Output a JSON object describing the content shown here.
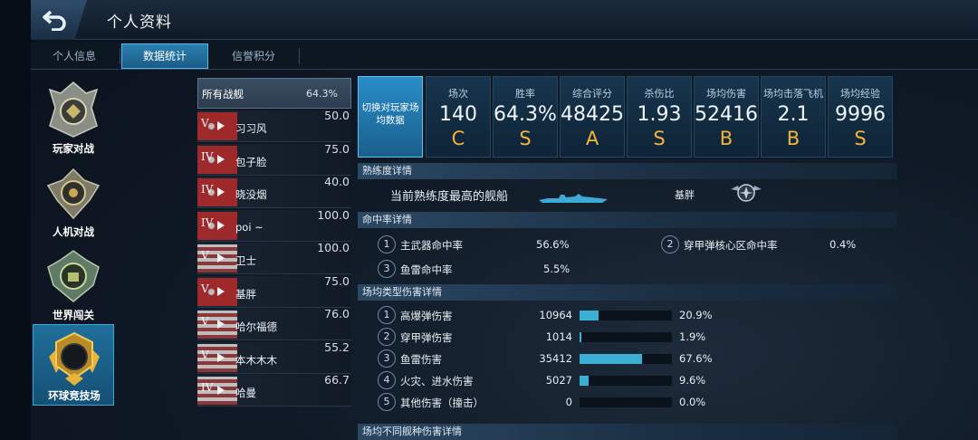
{
  "header": {
    "title": "个人资料"
  },
  "tabs": [
    "个人信息",
    "数据统计",
    "信誉积分"
  ],
  "active_tab": 1,
  "modes": [
    "玩家对战",
    "人机对战",
    "世界闯关",
    "环球竞技场"
  ],
  "active_mode": 3,
  "ship_list": {
    "all_label": "所有战舰",
    "all_rate": "64.3%",
    "ships": [
      {
        "tier": "V",
        "name": "习习风",
        "value": "50.0"
      },
      {
        "tier": "IV",
        "name": "包子脸",
        "value": "75.0"
      },
      {
        "tier": "IV",
        "name": "晓没烟",
        "value": "40.0"
      },
      {
        "tier": "IV",
        "name": "poi ~",
        "value": "100.0"
      },
      {
        "tier": "V",
        "name": "卫士",
        "value": "100.0"
      },
      {
        "tier": "V",
        "name": "基胖",
        "value": "75.0"
      },
      {
        "tier": "V",
        "name": "哈尔福德",
        "value": "76.0"
      },
      {
        "tier": "V",
        "name": "本木木木",
        "value": "55.2"
      },
      {
        "tier": "IV",
        "name": "哈曼",
        "value": "66.7"
      }
    ]
  },
  "switch_label": "切换对玩家场均数据",
  "stat_columns": [
    {
      "label": "场次",
      "value": "140",
      "grade": "C"
    },
    {
      "label": "胜率",
      "value": "64.3%",
      "grade": "S"
    },
    {
      "label": "综合评分",
      "value": "48425",
      "grade": "A"
    },
    {
      "label": "杀伤比",
      "value": "1.93",
      "grade": "S"
    },
    {
      "label": "场均伤害",
      "value": "52416",
      "grade": "B"
    },
    {
      "label": "场均击落飞机",
      "value": "2.1",
      "grade": "B"
    },
    {
      "label": "场均经验",
      "value": "9996",
      "grade": "S"
    }
  ],
  "proficiency": {
    "title": "熟练度详情",
    "label": "当前熟练度最高的舰船",
    "ship": "基胖"
  },
  "accuracy": {
    "title": "命中率详情",
    "items": [
      {
        "num": "1",
        "label": "主武器命中率",
        "value": "56.6%"
      },
      {
        "num": "2",
        "label": "穿甲弹核心区命中率",
        "value": "0.4%"
      },
      {
        "num": "3",
        "label": "鱼雷命中率",
        "value": "5.5%"
      }
    ]
  },
  "damage_types": {
    "title": "场均类型伤害详情",
    "items": [
      {
        "num": "1",
        "label": "高爆弹伤害",
        "value": "10964",
        "pct": "20.9%",
        "fraction": 0.209
      },
      {
        "num": "2",
        "label": "穿甲弹伤害",
        "value": "1014",
        "pct": "1.9%",
        "fraction": 0.019
      },
      {
        "num": "3",
        "label": "鱼雷伤害",
        "value": "35412",
        "pct": "67.6%",
        "fraction": 0.676
      },
      {
        "num": "4",
        "label": "火灾、进水伤害",
        "value": "5027",
        "pct": "9.6%",
        "fraction": 0.096
      },
      {
        "num": "5",
        "label": "其他伤害（撞击）",
        "value": "0",
        "pct": "0.0%",
        "fraction": 0.0
      }
    ]
  },
  "ship_class_damage": {
    "title": "场均不同舰种伤害详情"
  },
  "colors": {
    "accent": "#2a8cc6",
    "grade": "#f0b43a",
    "bar": "#3bb0d3"
  }
}
